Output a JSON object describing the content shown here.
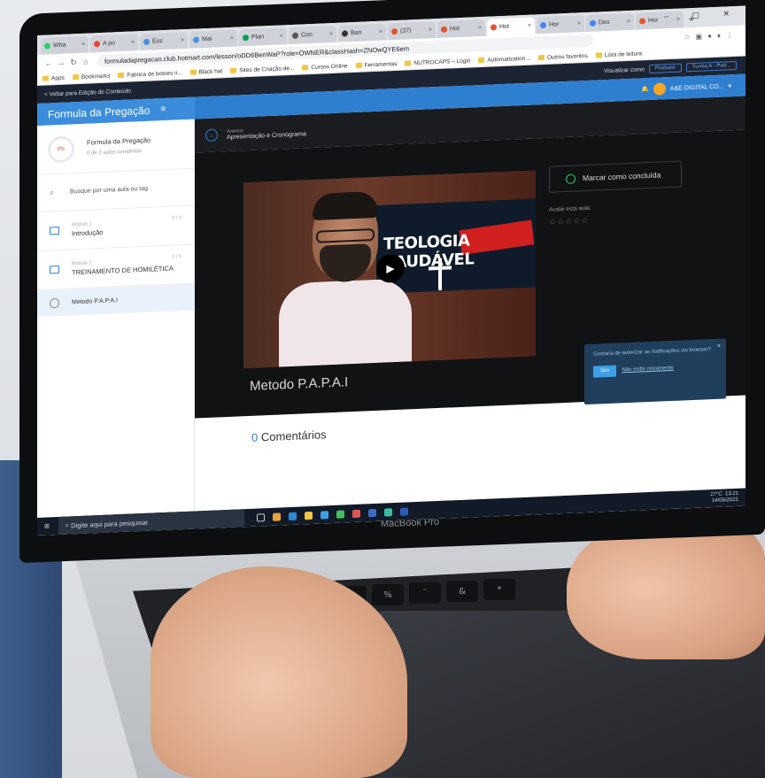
{
  "browser": {
    "tabs": [
      "Wha",
      "A po",
      "Eoc",
      "Mai",
      "Plan",
      "Con",
      "Ban",
      "(37)",
      "Hot",
      "Hot",
      "Hor",
      "Des",
      "Hor"
    ],
    "active_tab_index": 9,
    "url": "formuladapregacao.club.hotmart.com/lesson/oDD6BenWaP?role=OWNER&classHash=ZNOwQYE6em",
    "bookmarks": [
      "Apps",
      "Bookmarks",
      "Fabrica de botoes ii...",
      "Black hat",
      "Sites de Criação de...",
      "Cursos Online",
      "Ferramentas",
      "NUTROCAPS – Login",
      "Automatization...",
      "Outros favoritos",
      "Lista de leitura"
    ]
  },
  "topnav": {
    "back_link": "< Voltar para Edição do Conteúdo",
    "view_as_label": "Visualizar como",
    "view_as_value": "Produtor",
    "class_select": "Turma A - Pad..."
  },
  "user": {
    "name": "A&E DIGITAL CO..."
  },
  "sidebar": {
    "title": "Formula da Pregação",
    "course": {
      "progress": "0%",
      "name": "Formula da Pregação",
      "subtitle": "0 de 2 aulas completas"
    },
    "search_placeholder": "Busque por uma aula ou tag",
    "modules": [
      {
        "label": "Módulo 1",
        "name": "Introdução",
        "count": "0 / 1"
      },
      {
        "label": "Módulo 2",
        "name": "TREINAMENTO DE HOMILÉTICA",
        "count": "0 / 1"
      }
    ],
    "lesson": "Metodo P.A.P.A.I"
  },
  "lesson": {
    "prev_label": "Anterior",
    "prev_title": "Apresentação e Cronograma",
    "title": "Metodo P.A.P.A.I",
    "complete_button": "Marcar como concluída",
    "rate_label": "Avalie esta aula:",
    "stars": "☆☆☆☆☆",
    "video_banner": "TEOLOGIA SAUDÁVEL"
  },
  "notification": {
    "text": "Gostaria de autorizar as notificações via browser?",
    "yes": "Sim",
    "no": "Não exibir novamente"
  },
  "comments": {
    "count": "0",
    "label": "Comentários"
  },
  "taskbar": {
    "search": "Digite aqui para pesquisar",
    "temp": "27°C",
    "time": "13:21",
    "date": "14/06/2021"
  },
  "laptop": {
    "brand": "MacBook Pro"
  }
}
